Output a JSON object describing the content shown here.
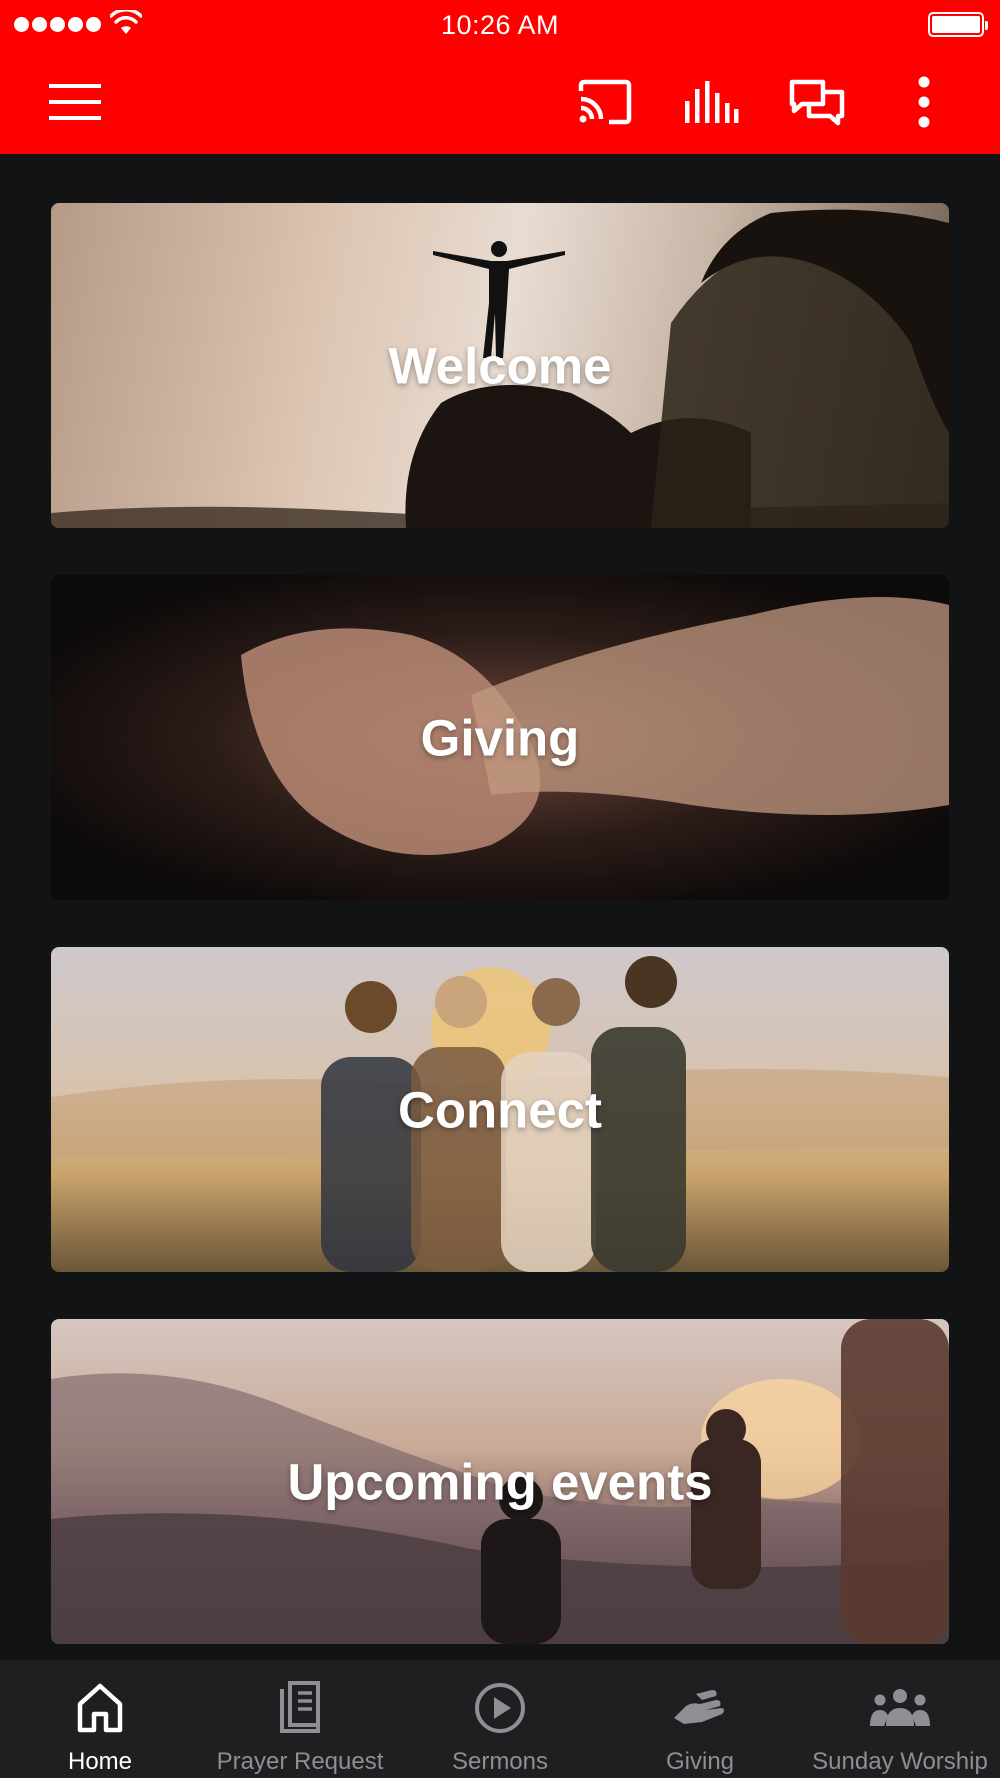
{
  "status_bar": {
    "time": "10:26 AM",
    "signal_icon": "signal-dots-icon",
    "wifi_icon": "wifi-icon",
    "battery_icon": "battery-icon"
  },
  "app_bar": {
    "color": "#ff0000",
    "icons": [
      "hamburger-menu-icon",
      "cast-icon",
      "equalizer-icon",
      "chat-icon",
      "more-vertical-icon"
    ]
  },
  "cards": [
    {
      "label": "Welcome"
    },
    {
      "label": "Giving"
    },
    {
      "label": "Connect"
    },
    {
      "label": "Upcoming events"
    }
  ],
  "tab_bar": {
    "active": "Home",
    "tabs": [
      {
        "label": "Home",
        "icon": "home-icon"
      },
      {
        "label": "Prayer Request",
        "icon": "book-icon"
      },
      {
        "label": "Sermons",
        "icon": "play-circle-icon"
      },
      {
        "label": "Giving",
        "icon": "giving-hand-icon"
      },
      {
        "label": "Sunday Worship",
        "icon": "group-icon"
      }
    ]
  },
  "colors": {
    "background": "#121315",
    "tab_bar": "#1d1f21",
    "tab_inactive": "#8e8f92",
    "tab_active": "#ffffff"
  }
}
